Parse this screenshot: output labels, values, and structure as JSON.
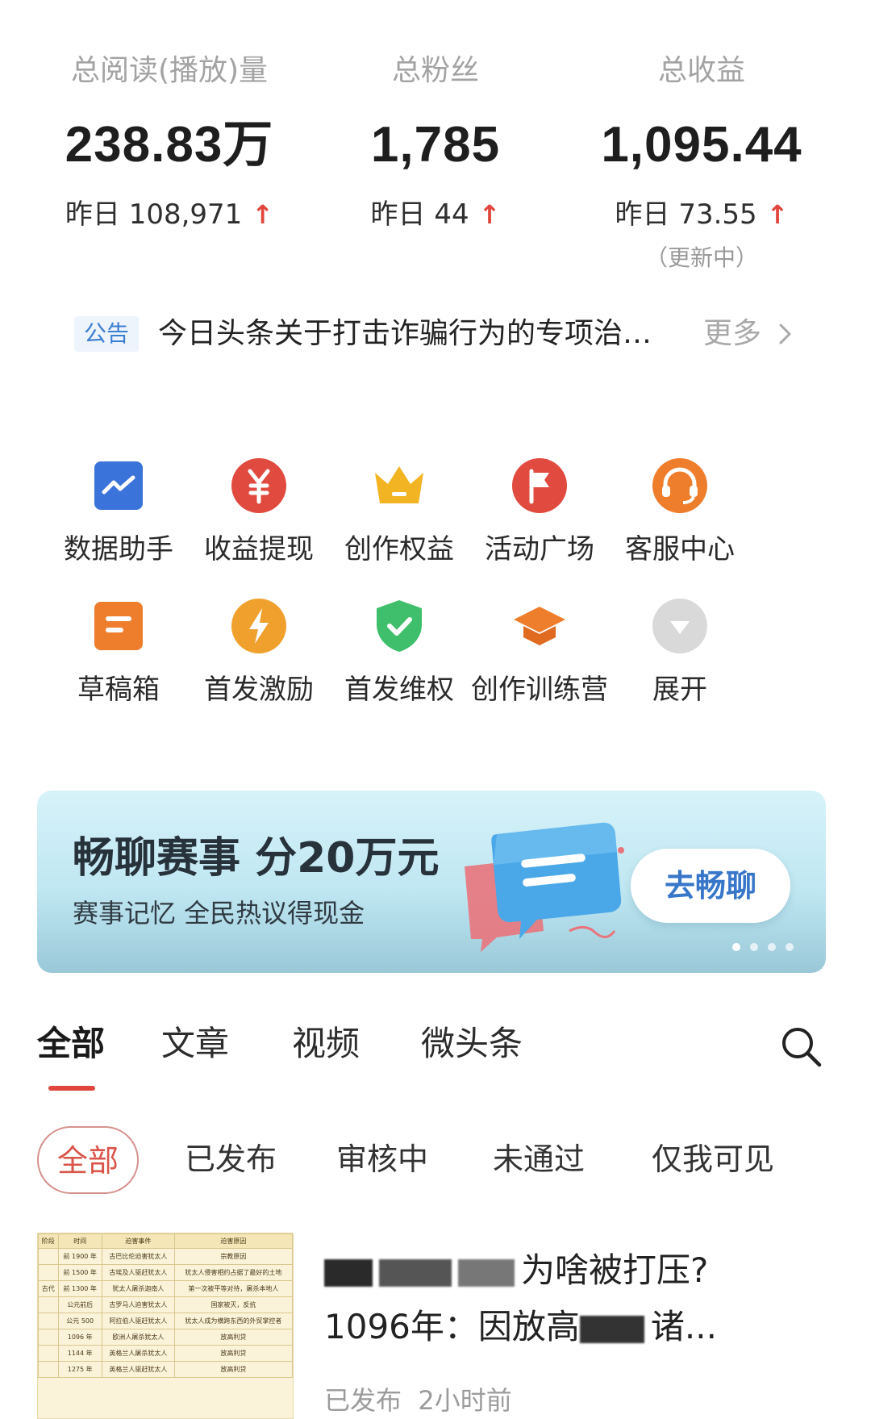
{
  "stats": [
    {
      "label": "总阅读(播放)量",
      "value": "238.83万",
      "yesterday": "昨日 108,971",
      "note": ""
    },
    {
      "label": "总粉丝",
      "value": "1,785",
      "yesterday": "昨日 44",
      "note": ""
    },
    {
      "label": "总收益",
      "value": "1,095.44",
      "yesterday": "昨日 73.55",
      "note": "（更新中）"
    }
  ],
  "stats_arrow": "↑",
  "notice": {
    "tag": "公告",
    "text": "今日头条关于打击诈骗行为的专项治…",
    "more": "更多"
  },
  "tools": [
    {
      "label": "数据助手",
      "icon": "chart-icon"
    },
    {
      "label": "收益提现",
      "icon": "yuan-icon"
    },
    {
      "label": "创作权益",
      "icon": "crown-icon"
    },
    {
      "label": "活动广场",
      "icon": "flag-icon"
    },
    {
      "label": "客服中心",
      "icon": "headset-icon"
    },
    {
      "label": "草稿箱",
      "icon": "draft-icon"
    },
    {
      "label": "首发激励",
      "icon": "lightning-icon"
    },
    {
      "label": "首发维权",
      "icon": "shield-icon"
    },
    {
      "label": "创作训练营",
      "icon": "graduation-cap-icon"
    },
    {
      "label": "展开",
      "icon": "expand-icon"
    }
  ],
  "banner": {
    "title": "畅聊赛事 分20万元",
    "subtitle": "赛事记忆 全民热议得现金",
    "cta": "去畅聊",
    "page_count": 4,
    "active_page": 1
  },
  "tabs": [
    "全部",
    "文章",
    "视频",
    "微头条"
  ],
  "active_tab": "全部",
  "filters": [
    "全部",
    "已发布",
    "审核中",
    "未通过",
    "仅我可见"
  ],
  "active_filter": "全部",
  "article": {
    "title_line1": "为啥被打压?",
    "title_line2_prefix": "1096年：因放高",
    "title_line2_suffix": "诸...",
    "status": "已发布",
    "time": "2小时前",
    "thumb_headers": [
      "阶段",
      "时间",
      "迫害事件",
      "迫害原因"
    ],
    "thumb_rows": [
      [
        "",
        "前 1900 年",
        "古巴比伦迫害犹太人",
        "宗教原因"
      ],
      [
        "",
        "前 1500 年",
        "古埃及人驱赶犹太人",
        "犹太人侵害相约占据了最好的土地"
      ],
      [
        "古代",
        "前 1300 年",
        "犹太人屠杀迦南人",
        "第一次被平等对待，屠杀本地人"
      ],
      [
        "",
        "公元前后",
        "古罗马人迫害犹太人",
        "国家被灭，反抗"
      ],
      [
        "",
        "公元 500",
        "阿拉伯人驱赶犹太人",
        "犹太人成为横跨东西的外贸掌控者"
      ],
      [
        "",
        "1096 年",
        "欧洲人屠杀犹太人",
        "放高利贷"
      ],
      [
        "",
        "1144 年",
        "英格兰人屠杀犹太人",
        "放高利贷"
      ],
      [
        "",
        "1275 年",
        "英格兰人驱赶犹太人",
        "放高利贷"
      ]
    ]
  },
  "colors": {
    "accent_red": "#e0463d",
    "notice_blue": "#3b7fd3",
    "cta_blue": "#3776c9"
  }
}
